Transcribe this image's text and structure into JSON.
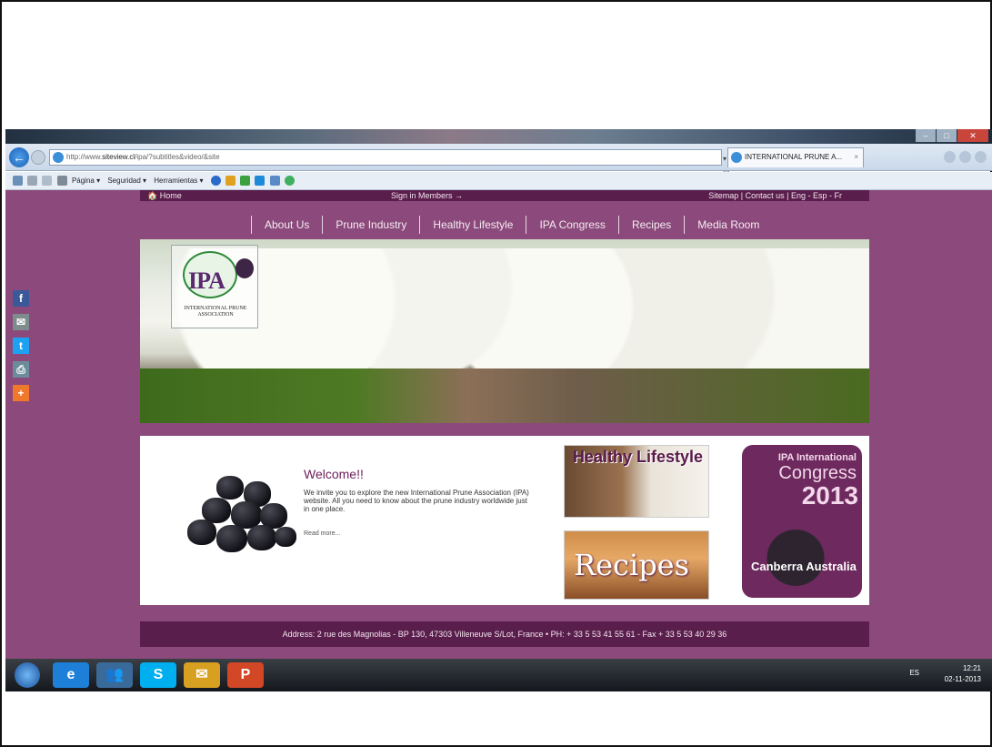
{
  "browser": {
    "url_prefix": "http://www.",
    "url_domain": "siteview.cl",
    "url_path": "/ipa/?subtitles&video/&site",
    "tab_title": "INTERNATIONAL PRUNE A...",
    "tab_close": "×",
    "url_controls": "▾ ▤ ↻",
    "command_bar": [
      "Página ▾",
      "Seguridad ▾",
      "Herramientas ▾"
    ]
  },
  "site": {
    "top_strip": {
      "home": "🏠 Home",
      "sign_in": "Sign in Members →",
      "right_links": "Sitemap  |  Contact us  |  Eng - Esp - Fr"
    },
    "nav": [
      "About Us",
      "Prune Industry",
      "Healthy Lifestyle",
      "IPA Congress",
      "Recipes",
      "Media Room"
    ],
    "logo": {
      "acronym": "IPA",
      "name": "INTERNATIONAL PRUNE ASSOCIATION"
    },
    "welcome": {
      "title": "Welcome!!",
      "text": "We invite you to explore the new International Prune Association (IPA) website. All you need to know about the prune industry worldwide just in one place.",
      "read_more": "Read more..."
    },
    "promos": {
      "healthy": "Healthy Lifestyle",
      "recipes": "Recipes",
      "congress_l1": "IPA International",
      "congress_l2": "Congress",
      "congress_l3": "2013",
      "congress_l4": "Canberra Australia"
    },
    "footer": "Address: 2 rue des Magnolias - BP 130, 47303 Villeneuve S/Lot, France • PH: + 33 5 53 41 55 61 - Fax + 33 5 53 40 29 36"
  },
  "social": [
    {
      "icon": "facebook-icon",
      "glyph": "f",
      "color": "#3b5998"
    },
    {
      "icon": "email-icon",
      "glyph": "✉",
      "color": "#7f8c8d"
    },
    {
      "icon": "twitter-icon",
      "glyph": "t",
      "color": "#1da1f2"
    },
    {
      "icon": "print-icon",
      "glyph": "⎙",
      "color": "#6c8c9c"
    },
    {
      "icon": "share-plus-icon",
      "glyph": "+",
      "color": "#f0782a"
    }
  ],
  "taskbar": {
    "language": "ES",
    "time": "12:21",
    "date": "02-11-2013",
    "apps": [
      {
        "icon": "internet-explorer-icon",
        "glyph": "e",
        "color": "#1e7fd8"
      },
      {
        "icon": "people-icon",
        "glyph": "👥",
        "color": "#3a6a9a"
      },
      {
        "icon": "skype-icon",
        "glyph": "S",
        "color": "#00aff0"
      },
      {
        "icon": "outlook-icon",
        "glyph": "✉",
        "color": "#d8a020"
      },
      {
        "icon": "powerpoint-icon",
        "glyph": "P",
        "color": "#d24726"
      }
    ]
  }
}
